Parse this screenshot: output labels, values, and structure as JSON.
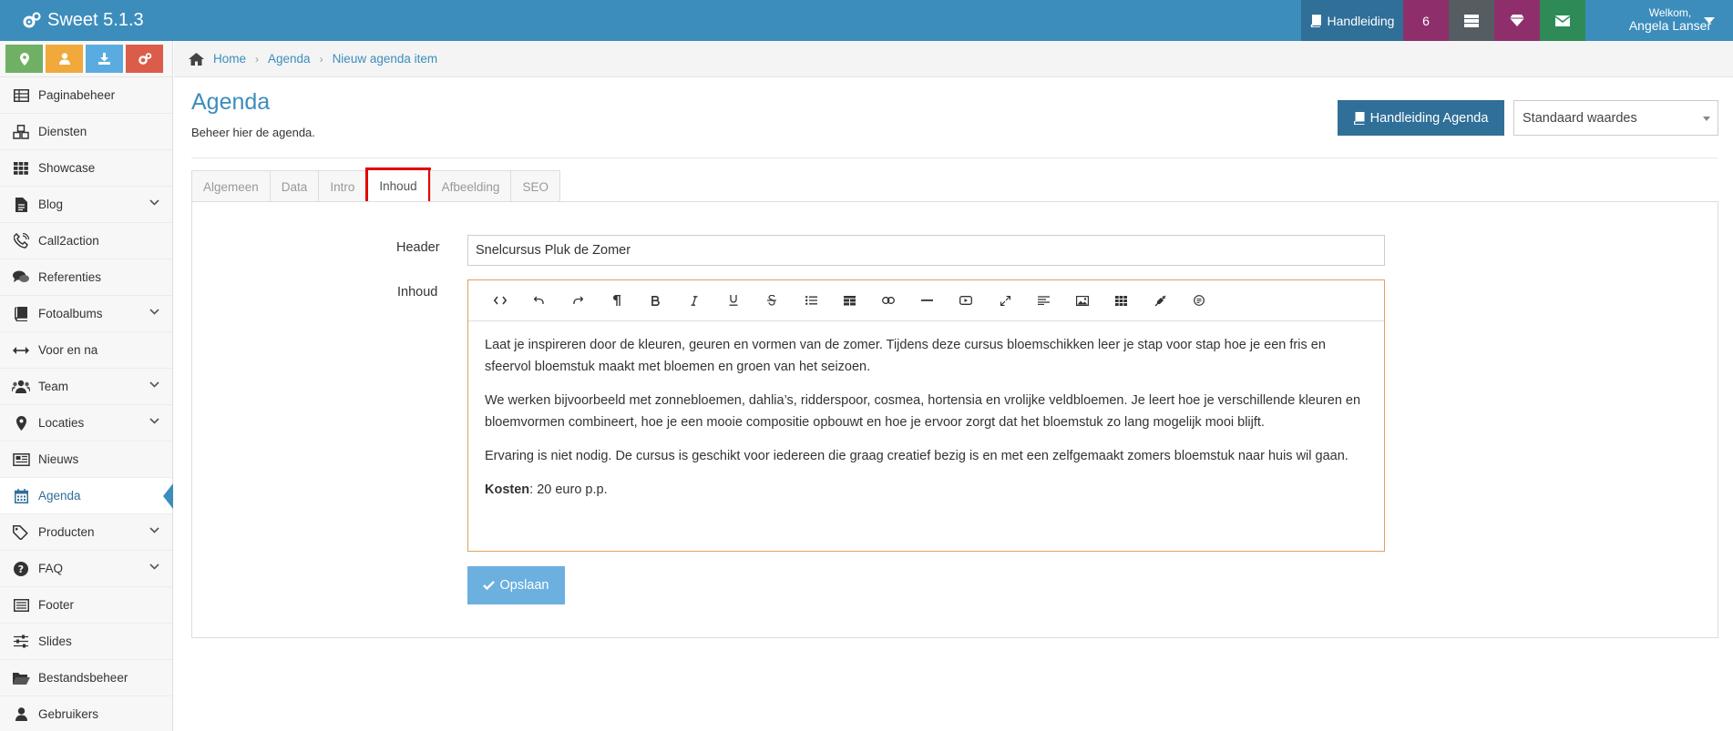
{
  "app": {
    "title": "Sweet 5.1.3"
  },
  "topnav": {
    "manual_label": "Handleiding",
    "count": "6",
    "welcome": "Welkom,",
    "user_name": "Angela Lanser"
  },
  "quick_buttons": [
    "map-marker-icon",
    "user-icon",
    "download-icon",
    "cogs-icon"
  ],
  "sidebar": {
    "items": [
      {
        "label": "Paginabeheer",
        "icon": "table-icon"
      },
      {
        "label": "Diensten",
        "icon": "cubes-icon"
      },
      {
        "label": "Showcase",
        "icon": "grid-icon"
      },
      {
        "label": "Blog",
        "icon": "file-text-icon"
      },
      {
        "label": "Call2action",
        "icon": "phone-volume-icon"
      },
      {
        "label": "Referenties",
        "icon": "comments-icon"
      },
      {
        "label": "Fotoalbums",
        "icon": "book-icon"
      },
      {
        "label": "Voor en na",
        "icon": "arrows-h-icon"
      },
      {
        "label": "Team",
        "icon": "users-icon"
      },
      {
        "label": "Locaties",
        "icon": "map-marker-icon"
      },
      {
        "label": "Nieuws",
        "icon": "newspaper-icon"
      },
      {
        "label": "Agenda",
        "icon": "calendar-icon"
      },
      {
        "label": "Producten",
        "icon": "tags-icon"
      },
      {
        "label": "FAQ",
        "icon": "question-circle-icon"
      },
      {
        "label": "Footer",
        "icon": "list-alt-icon"
      },
      {
        "label": "Slides",
        "icon": "sliders-icon"
      },
      {
        "label": "Bestandsbeheer",
        "icon": "folder-open-icon"
      },
      {
        "label": "Gebruikers",
        "icon": "user-icon"
      }
    ]
  },
  "breadcrumb": {
    "home": "Home",
    "section": "Agenda",
    "current": "Nieuw agenda item"
  },
  "page": {
    "title": "Agenda",
    "subtitle": "Beheer hier de agenda.",
    "manual_button": "Handleiding Agenda",
    "defaults_select": "Standaard waardes"
  },
  "tabs": [
    "Algemeen",
    "Data",
    "Intro",
    "Inhoud",
    "Afbeelding",
    "SEO"
  ],
  "active_tab": "Inhoud",
  "form": {
    "header_label": "Header",
    "header_value": "Snelcursus Pluk de Zomer",
    "content_label": "Inhoud",
    "content": {
      "p1": "Laat je inspireren door de kleuren, geuren en vormen van de zomer. Tijdens deze cursus bloemschikken leer je stap voor stap hoe je een fris en sfeervol bloemstuk maakt met bloemen en groen van het seizoen.",
      "p2": "We werken bijvoorbeeld met zonnebloemen, dahlia’s, ridderspoor, cosmea, hortensia en vrolijke veldbloemen. Je leert hoe je verschillende kleuren en bloemvormen combineert, hoe je een mooie compositie opbouwt en hoe je ervoor zorgt dat het bloemstuk zo lang mogelijk mooi blijft.",
      "p3": "Ervaring is niet nodig. De cursus is geschikt voor iedereen die graag creatief bezig is en met een zelfgemaakt zomers bloemstuk naar huis wil gaan.",
      "cost_label": "Kosten",
      "cost_value": ": 20 euro p.p."
    },
    "save_button": "Opslaan"
  },
  "colors": {
    "primary": "#3c8dbc",
    "dark_primary": "#2f6f98",
    "highlight": "#e00000"
  }
}
